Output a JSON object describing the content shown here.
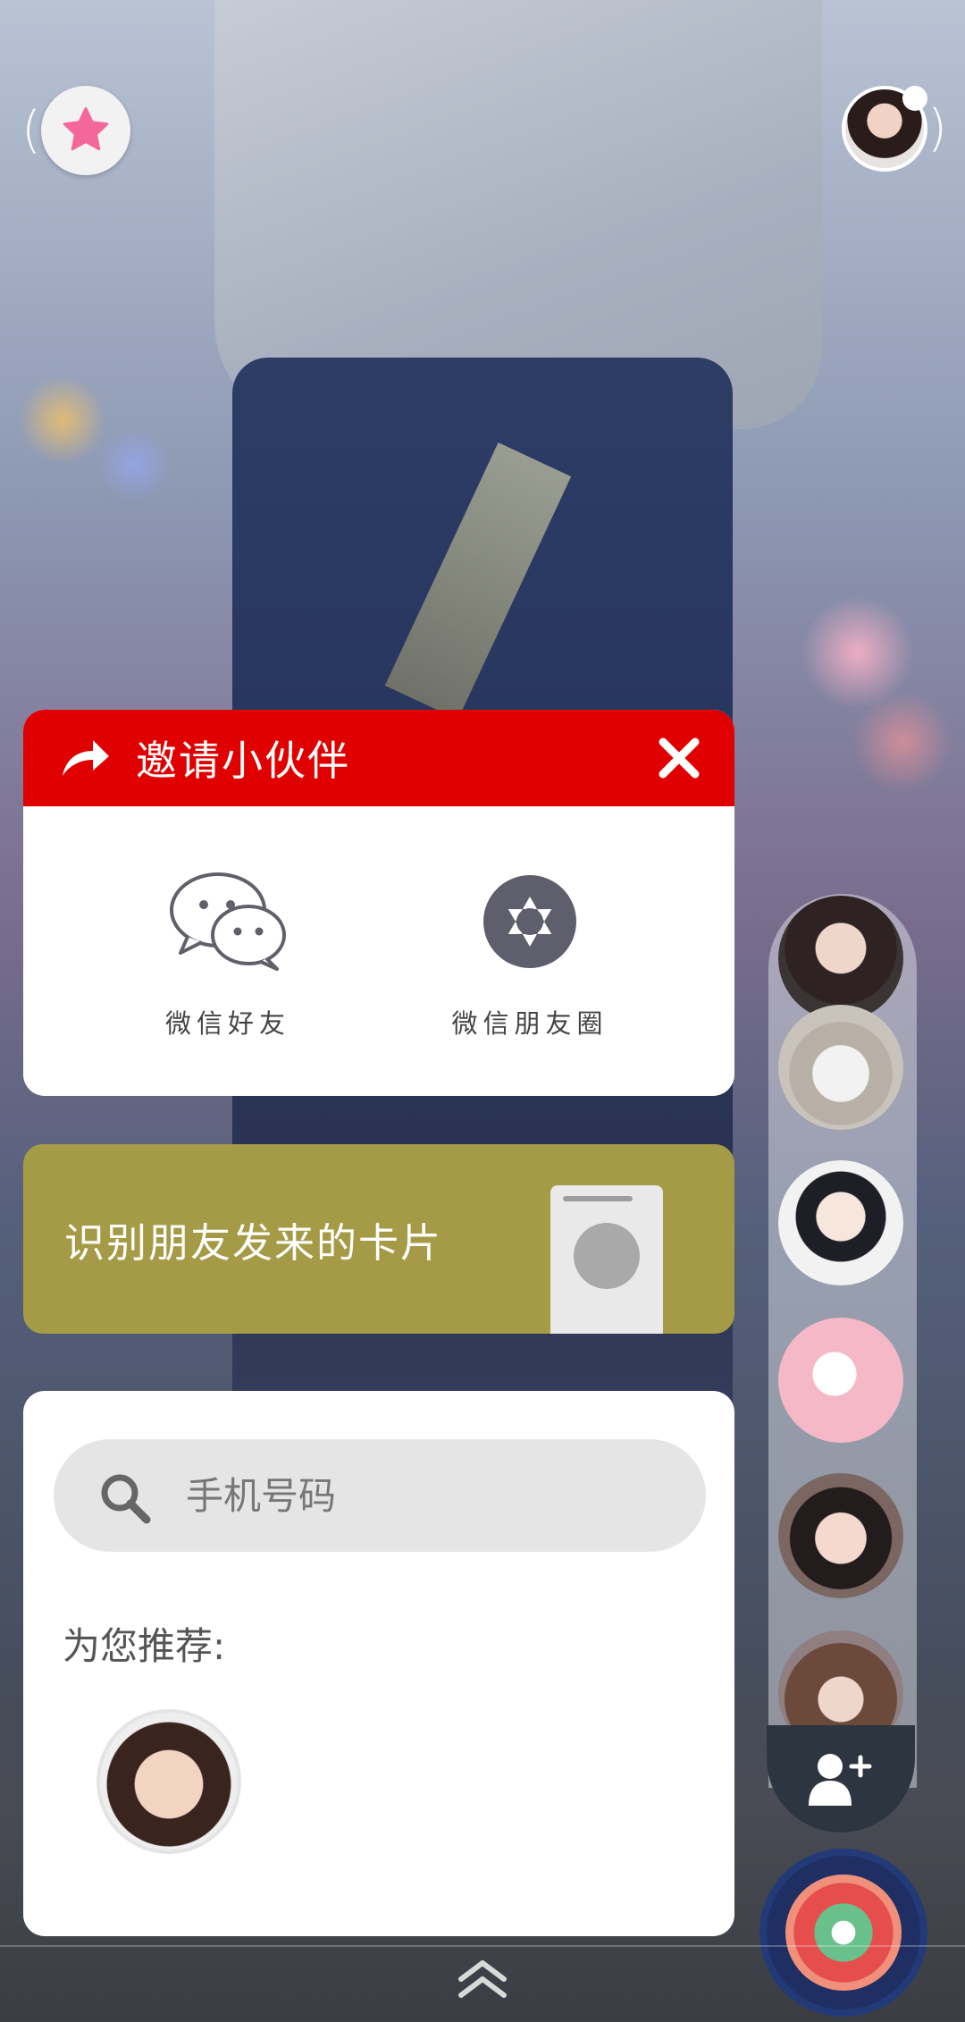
{
  "invite": {
    "title": "邀请小伙伴",
    "options": [
      {
        "label": "微信好友",
        "icon": "wechat-icon"
      },
      {
        "label": "微信朋友圈",
        "icon": "moments-icon"
      }
    ]
  },
  "scan_card": {
    "label": "识别朋友发来的卡片"
  },
  "search": {
    "placeholder": "手机号码"
  },
  "recommend": {
    "label": "为您推荐:"
  },
  "colors": {
    "accent_red": "#e00000",
    "card_olive": "#a59a45",
    "favorite_pink": "#f4679a"
  }
}
